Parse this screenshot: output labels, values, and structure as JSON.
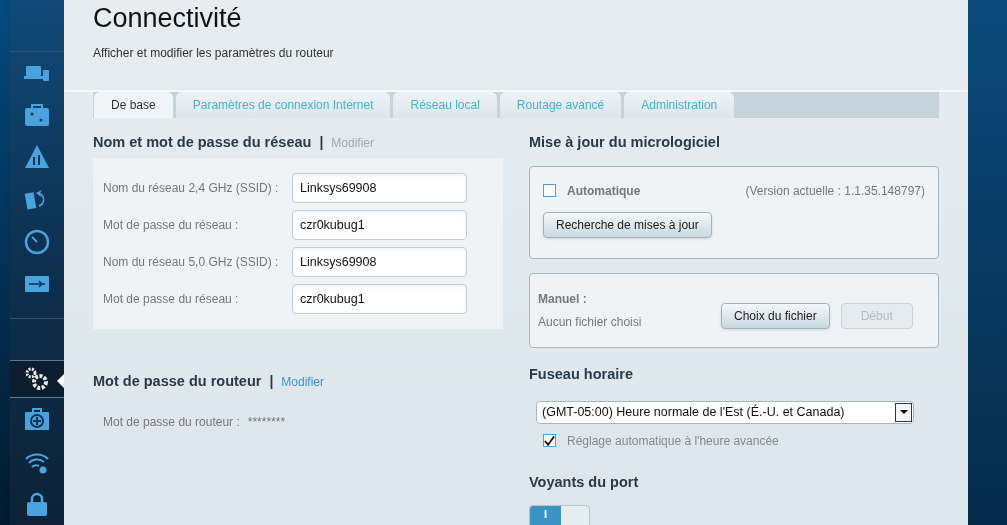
{
  "sidebar": {
    "items": [
      {
        "kind": "devices",
        "selected": false
      },
      {
        "kind": "map",
        "selected": false
      },
      {
        "kind": "family",
        "selected": false
      },
      {
        "kind": "priority",
        "selected": false
      },
      {
        "kind": "speed",
        "selected": false
      },
      {
        "kind": "usb",
        "selected": false
      },
      {
        "kind": "gears",
        "selected": true
      },
      {
        "kind": "kit",
        "selected": false
      },
      {
        "kind": "wifi",
        "selected": false
      },
      {
        "kind": "lock",
        "selected": false
      }
    ]
  },
  "header": {
    "title": "Connectivité",
    "subtitle": "Afficher et modifier les paramètres du routeur"
  },
  "tabs": [
    {
      "label": "De base",
      "selected": true
    },
    {
      "label": "Paramètres de connexion Internet",
      "selected": false
    },
    {
      "label": "Réseau local",
      "selected": false
    },
    {
      "label": "Routage avancé",
      "selected": false
    },
    {
      "label": "Administration",
      "selected": false
    }
  ],
  "network_section": {
    "title": "Nom et mot de passe du réseau",
    "separator": "|",
    "modify": {
      "label": "Modifier",
      "disabled": true
    },
    "fields": [
      {
        "label": "Nom du réseau 2,4 GHz (SSID) :",
        "value": "Linksys69908"
      },
      {
        "label": "Mot de passe du réseau :",
        "value": "czr0kubug1"
      },
      {
        "label": "Nom du réseau 5,0 GHz (SSID) :",
        "value": "Linksys69908"
      },
      {
        "label": "Mot de passe du réseau :",
        "value": "czr0kubug1"
      }
    ]
  },
  "router_password": {
    "title": "Mot de passe du routeur",
    "separator": "|",
    "modify": {
      "label": "Modifier",
      "disabled": false
    },
    "label": "Mot de passe du routeur :",
    "value": "********"
  },
  "firmware": {
    "title": "Mise à jour du micrologiciel",
    "automatic": {
      "label": "Automatique",
      "checked": false
    },
    "version": "(Version actuelle : 1.1.35.148797)",
    "check_button": "Recherche de mises à jour",
    "manual": {
      "label": "Manuel :",
      "file_status": "Aucun fichier choisi",
      "choose_button": "Choix du fichier",
      "start_button": {
        "label": "Début",
        "disabled": true
      }
    }
  },
  "time_zone": {
    "title": "Fuseau horaire",
    "value": "(GMT-05:00) Heure normale de l'Est (É.-U. et Canada)",
    "dst": {
      "label": "Réglage automatique à l'heure avancée",
      "checked": true
    }
  },
  "port_lights": {
    "title": "Voyants du port",
    "toggle": {
      "label": "I",
      "on": true
    }
  }
}
